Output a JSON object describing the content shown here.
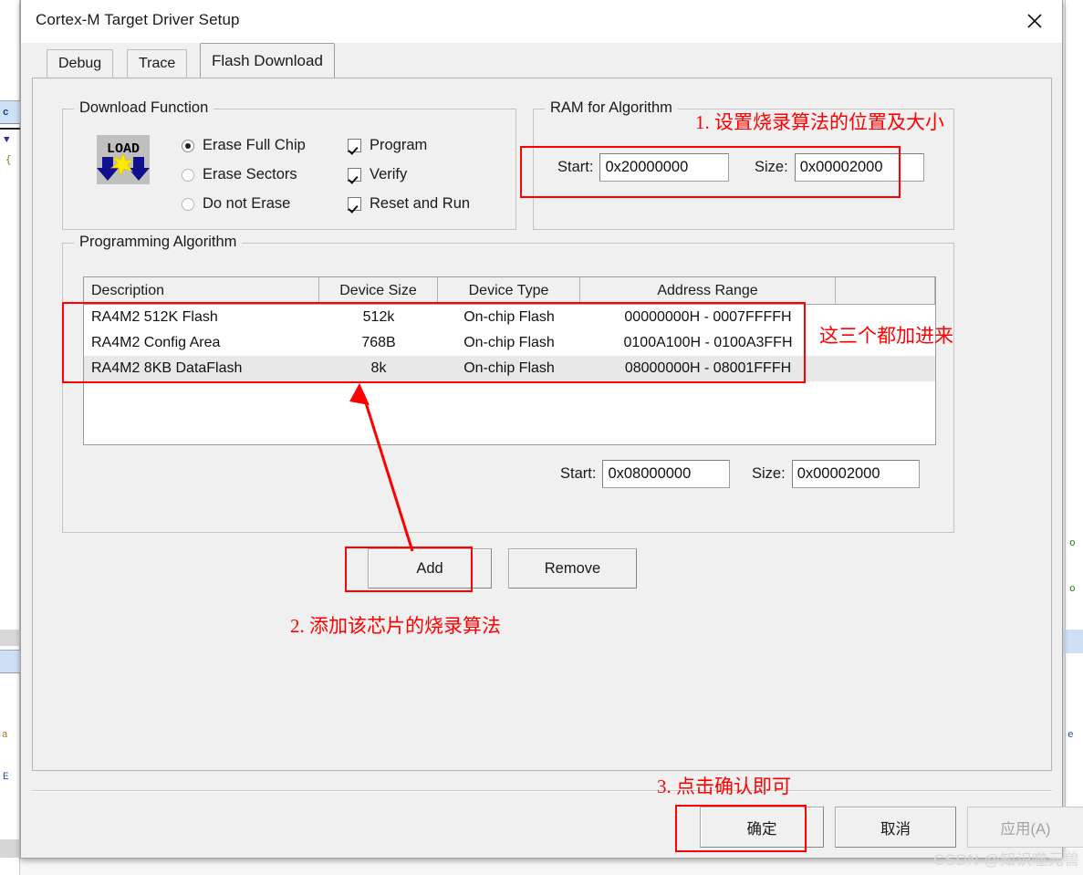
{
  "window": {
    "title": "Cortex-M Target Driver Setup",
    "close_icon": "close-icon"
  },
  "tabs": [
    {
      "label": "Debug",
      "active": false
    },
    {
      "label": "Trace",
      "active": false
    },
    {
      "label": "Flash Download",
      "active": true
    }
  ],
  "download_function": {
    "group_title": "Download Function",
    "icon": "load-flash-icon",
    "icon_text": "LOAD",
    "radios": [
      {
        "label": "Erase Full Chip",
        "checked": true
      },
      {
        "label": "Erase Sectors",
        "checked": false
      },
      {
        "label": "Do not Erase",
        "checked": false
      }
    ],
    "checkboxes": [
      {
        "label": "Program",
        "checked": true
      },
      {
        "label": "Verify",
        "checked": true
      },
      {
        "label": "Reset and Run",
        "checked": true
      }
    ]
  },
  "ram_for_algorithm": {
    "group_title": "RAM for Algorithm",
    "start_label": "Start:",
    "start_value": "0x20000000",
    "size_label": "Size:",
    "size_value": "0x00002000"
  },
  "programming_algorithm": {
    "group_title": "Programming Algorithm",
    "columns": [
      "Description",
      "Device Size",
      "Device Type",
      "Address Range",
      ""
    ],
    "rows": [
      {
        "description": "RA4M2 512K Flash",
        "device_size": "512k",
        "device_type": "On-chip Flash",
        "address_range": "00000000H - 0007FFFFH",
        "selected": false
      },
      {
        "description": "RA4M2 Config Area",
        "device_size": "768B",
        "device_type": "On-chip Flash",
        "address_range": "0100A100H - 0100A3FFH",
        "selected": false
      },
      {
        "description": "RA4M2 8KB DataFlash",
        "device_size": "8k",
        "device_type": "On-chip Flash",
        "address_range": "08000000H - 08001FFFH",
        "selected": true
      }
    ],
    "start_label": "Start:",
    "start_value": "0x08000000",
    "size_label": "Size:",
    "size_value": "0x00002000"
  },
  "buttons": {
    "add": "Add",
    "remove": "Remove",
    "ok": "确定",
    "cancel": "取消",
    "apply": "应用(A)"
  },
  "annotations": {
    "note1": "1. 设置烧录算法的位置及大小",
    "note2": "2. 添加该芯片的烧录算法",
    "note3": "3. 点击确认即可",
    "note4": "这三个都加进来",
    "color": "#ff0000"
  },
  "watermark": "CSDN @知识噬元兽"
}
